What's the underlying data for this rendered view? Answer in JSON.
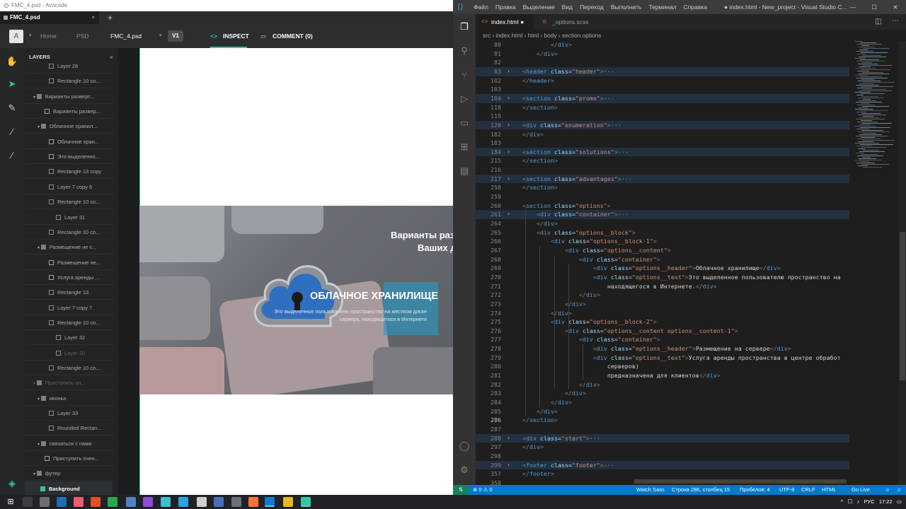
{
  "avocode": {
    "window_title": "FMC_4.psd - Avocode",
    "tab_label": "FMC_4.psd",
    "tab_close": "×",
    "new_tab": "+",
    "avatar_letter": "A",
    "breadcrumb": [
      "Home",
      "PSD",
      "FMC_4.psd"
    ],
    "version": "V1",
    "inspect_label": "INSPECT",
    "comment_label": "COMMENT (0)",
    "layers_title": "LAYERS",
    "layers_close": "×",
    "layers": [
      {
        "label": "Layer 28",
        "indent": 34,
        "icon": "image",
        "state": "normal"
      },
      {
        "label": "Rectangle 10 co...",
        "indent": 34,
        "icon": "shape",
        "state": "normal"
      },
      {
        "label": "Варианты разверт...",
        "indent": 12,
        "icon": "folder",
        "state": "normal"
      },
      {
        "label": "Варианты развер...",
        "indent": 28,
        "icon": "text",
        "state": "normal"
      },
      {
        "label": "Облачное хранил...",
        "indent": 18,
        "icon": "folder",
        "state": "normal"
      },
      {
        "label": "Облачное хран...",
        "indent": 34,
        "icon": "text",
        "state": "normal"
      },
      {
        "label": "Это выделенно...",
        "indent": 34,
        "icon": "text",
        "state": "normal"
      },
      {
        "label": "Rectangle 13 copy",
        "indent": 34,
        "icon": "shape",
        "state": "normal"
      },
      {
        "label": "Layer 7 copy 6",
        "indent": 34,
        "icon": "image",
        "state": "normal"
      },
      {
        "label": "Rectangle 10 co...",
        "indent": 34,
        "icon": "shape",
        "state": "normal"
      },
      {
        "label": "Layer 31",
        "indent": 44,
        "icon": "image",
        "state": "normal"
      },
      {
        "label": "Rectangle 10 co...",
        "indent": 34,
        "icon": "shape",
        "state": "normal"
      },
      {
        "label": "Размещение не с...",
        "indent": 18,
        "icon": "folder",
        "state": "normal"
      },
      {
        "label": "Размещение не...",
        "indent": 34,
        "icon": "text",
        "state": "normal"
      },
      {
        "label": "Услуга аренды ...",
        "indent": 34,
        "icon": "text",
        "state": "normal"
      },
      {
        "label": "Rectangle 13",
        "indent": 34,
        "icon": "shape",
        "state": "normal"
      },
      {
        "label": "Layer 7 copy 7",
        "indent": 34,
        "icon": "image",
        "state": "normal"
      },
      {
        "label": "Rectangle 10 co...",
        "indent": 34,
        "icon": "shape",
        "state": "normal"
      },
      {
        "label": "Layer 32",
        "indent": 44,
        "icon": "image",
        "state": "normal"
      },
      {
        "label": "Layer 30",
        "indent": 44,
        "icon": "image",
        "state": "dim"
      },
      {
        "label": "Rectangle 10 co...",
        "indent": 34,
        "icon": "shape",
        "state": "normal"
      },
      {
        "label": "Приступить он...",
        "indent": 12,
        "icon": "folder",
        "state": "dim"
      },
      {
        "label": "иконка",
        "indent": 18,
        "icon": "folder",
        "state": "normal"
      },
      {
        "label": "Layer 33",
        "indent": 34,
        "icon": "image",
        "state": "normal"
      },
      {
        "label": "Rounded Rectan...",
        "indent": 34,
        "icon": "shape",
        "state": "normal"
      },
      {
        "label": "связаться с нами",
        "indent": 18,
        "icon": "folder",
        "state": "normal"
      },
      {
        "label": "Приступить очен...",
        "indent": 28,
        "icon": "text",
        "state": "normal"
      },
      {
        "label": "футер",
        "indent": 12,
        "icon": "folder",
        "state": "normal"
      },
      {
        "label": "Background",
        "indent": 22,
        "icon": "image",
        "state": "selected"
      }
    ],
    "banner": {
      "title_line1": "Варианты раз",
      "title_line2": "Ваших д",
      "heading": "ОБЛАЧНОЕ ХРАНИЛИЩЕ",
      "text": "Это выделенное пользователю пространство на жестком диске сервера, находящегося в Интернете"
    }
  },
  "vscode": {
    "menu": [
      "Файл",
      "Правка",
      "Выделение",
      "Вид",
      "Переход",
      "Выполнить",
      "Терминал",
      "Справка"
    ],
    "window_title": "● index.html - New_project - Visual Studio C...",
    "window_controls": [
      "—",
      "☐",
      "✕"
    ],
    "tabs": [
      {
        "label": "index.html ●",
        "active": true
      },
      {
        "label": "_options.scss",
        "active": false
      }
    ],
    "breadcrumb": "src  ›  index.html  ›  html  ›  body  ›  section.options",
    "lines": [
      {
        "n": "80",
        "code": "        </div>",
        "fold": false,
        "hl": false
      },
      {
        "n": "81",
        "code": "    </div>",
        "fold": false,
        "hl": false
      },
      {
        "n": "82",
        "code": "",
        "fold": false,
        "hl": false
      },
      {
        "n": "83",
        "code": "<header class=\"header\">···",
        "fold": true,
        "hl": true
      },
      {
        "n": "102",
        "code": "</header>",
        "fold": false,
        "hl": false
      },
      {
        "n": "103",
        "code": "",
        "fold": false,
        "hl": false
      },
      {
        "n": "104",
        "code": "<section class=\"promo\">···",
        "fold": true,
        "hl": true
      },
      {
        "n": "118",
        "code": "</section>",
        "fold": false,
        "hl": false
      },
      {
        "n": "119",
        "code": "",
        "fold": false,
        "hl": false
      },
      {
        "n": "120",
        "code": "<div class=\"enumeration\">···",
        "fold": true,
        "hl": true
      },
      {
        "n": "182",
        "code": "</div>",
        "fold": false,
        "hl": false
      },
      {
        "n": "183",
        "code": "",
        "fold": false,
        "hl": false
      },
      {
        "n": "184",
        "code": "<section class=\"solutions\">···",
        "fold": true,
        "hl": true
      },
      {
        "n": "215",
        "code": "</section>",
        "fold": false,
        "hl": false
      },
      {
        "n": "216",
        "code": "",
        "fold": false,
        "hl": false
      },
      {
        "n": "217",
        "code": "<section class=\"advantages\">···",
        "fold": true,
        "hl": true
      },
      {
        "n": "258",
        "code": "</section>",
        "fold": false,
        "hl": false
      },
      {
        "n": "259",
        "code": "",
        "fold": false,
        "hl": false
      },
      {
        "n": "260",
        "code": "<section class=\"options\">",
        "fold": false,
        "hl": false
      },
      {
        "n": "261",
        "code": "    <div class=\"container\">···",
        "fold": true,
        "hl": true
      },
      {
        "n": "264",
        "code": "    </div>",
        "fold": false,
        "hl": false
      },
      {
        "n": "265",
        "code": "    <div class=\"options__block\">",
        "fold": false,
        "hl": false
      },
      {
        "n": "266",
        "code": "        <div class=\"options__block-1\">",
        "fold": false,
        "hl": false
      },
      {
        "n": "267",
        "code": "            <div class=\"options__content\">",
        "fold": false,
        "hl": false
      },
      {
        "n": "268",
        "code": "                <div class=\"container\">",
        "fold": false,
        "hl": false
      },
      {
        "n": "269",
        "code": "                    <div class=\"options__header\">Облачное хранилище</div>",
        "fold": false,
        "hl": false
      },
      {
        "n": "270",
        "code": "                    <div class=\"options__text\">Это выделенное пользователю пространство на",
        "fold": false,
        "hl": false
      },
      {
        "n": "271",
        "code": "                        находящегося в Интернете.</div>",
        "fold": false,
        "hl": false
      },
      {
        "n": "272",
        "code": "                </div>",
        "fold": false,
        "hl": false
      },
      {
        "n": "273",
        "code": "            </div>",
        "fold": false,
        "hl": false
      },
      {
        "n": "274",
        "code": "        </div>",
        "fold": false,
        "hl": false
      },
      {
        "n": "275",
        "code": "        <div class=\"options__block-2\">",
        "fold": false,
        "hl": false
      },
      {
        "n": "276",
        "code": "            <div class=\"options__content options__content-1\">",
        "fold": false,
        "hl": false
      },
      {
        "n": "277",
        "code": "                <div class=\"container\">",
        "fold": false,
        "hl": false
      },
      {
        "n": "278",
        "code": "                    <div class=\"options__header\">Размещение на сервере</div>",
        "fold": false,
        "hl": false
      },
      {
        "n": "279",
        "code": "                    <div class=\"options__text\">Услуга аренды пространства в центре обработ",
        "fold": false,
        "hl": false
      },
      {
        "n": "280",
        "code": "                        серверов)",
        "fold": false,
        "hl": false
      },
      {
        "n": "281",
        "code": "                        предназначена для клиентов</div>",
        "fold": false,
        "hl": false
      },
      {
        "n": "282",
        "code": "                </div>",
        "fold": false,
        "hl": false
      },
      {
        "n": "283",
        "code": "            </div>",
        "fold": false,
        "hl": false
      },
      {
        "n": "284",
        "code": "        </div>",
        "fold": false,
        "hl": false
      },
      {
        "n": "285",
        "code": "    </div>",
        "fold": false,
        "hl": false
      },
      {
        "n": "286",
        "code": "</section>",
        "fold": false,
        "hl": false,
        "cur": true
      },
      {
        "n": "287",
        "code": "",
        "fold": false,
        "hl": false
      },
      {
        "n": "288",
        "code": "<div class=\"start\">···",
        "fold": true,
        "hl": true
      },
      {
        "n": "297",
        "code": "</div>",
        "fold": false,
        "hl": false
      },
      {
        "n": "298",
        "code": "",
        "fold": false,
        "hl": false
      },
      {
        "n": "299",
        "code": "<footer class=\"footer\">···",
        "fold": true,
        "hl": true
      },
      {
        "n": "357",
        "code": "</footer>",
        "fold": false,
        "hl": false
      },
      {
        "n": "358",
        "code": "",
        "fold": false,
        "hl": false
      }
    ],
    "status": {
      "remote": "⇅",
      "problems": "⊗ 0  ⚠ 0",
      "watch": "Watch Sass",
      "position": "Строка 286, столбец 15",
      "spaces": "Пробелов: 4",
      "encoding": "UTF-8",
      "eol": "CRLF",
      "language": "HTML",
      "live": "Go Live"
    }
  },
  "taskbar": {
    "lang": "РУС",
    "time": "17:22"
  },
  "colors": {
    "accent": "#2fc8a3",
    "vscode_status": "#007acc",
    "vscode_bg": "#1e1e1e",
    "avocode_bg": "#1d1f21"
  }
}
